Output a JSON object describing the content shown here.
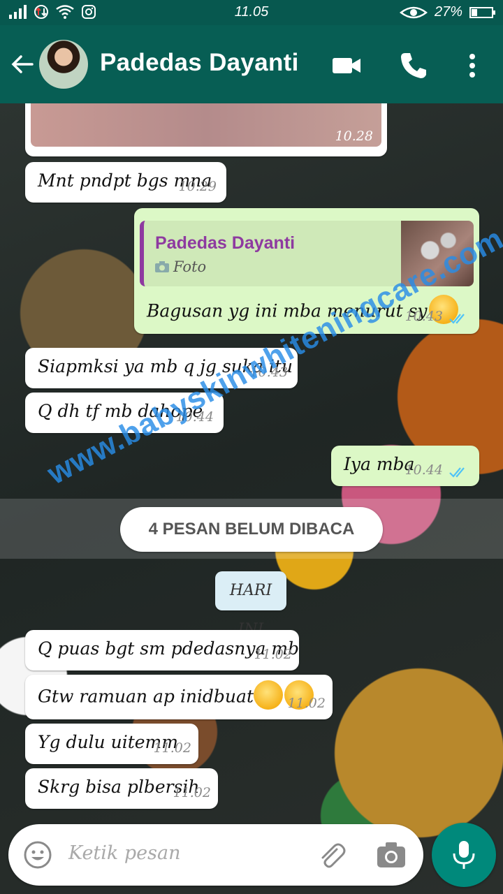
{
  "status_bar": {
    "time": "11.05",
    "battery": "27%",
    "battery_level": 0.27
  },
  "header": {
    "contact_name": "Padedas Dayanti"
  },
  "messages": [
    {
      "text": "",
      "time": "10.28"
    },
    {
      "text": "Mnt pndpt bgs mna",
      "time": "10.29"
    },
    {
      "quote_name": "Padedas Dayanti",
      "quote_type": "Foto",
      "text": "Bagusan yg ini mba menurut sy",
      "time": "10.43"
    },
    {
      "text": "Siapmksi ya mb q jg suka itu",
      "time": "10.43"
    },
    {
      "text": "Q dh tf mb dahope",
      "time": "10.44"
    },
    {
      "text": "Iya mba",
      "time": "10.44"
    },
    {
      "text": "Q puas bgt sm pdedasnya mb",
      "time": "11.02"
    },
    {
      "text": "Gtw ramuan ap inidbuat",
      "time": "11.02"
    },
    {
      "text": "Yg dulu uitemm",
      "time": "11.02"
    },
    {
      "text": "Skrg bisa plbersih",
      "time": "11.02"
    }
  ],
  "unread_banner": "4 PESAN BELUM DIBACA",
  "date_chip": "HARI INI",
  "watermark": "www.babyskinwhiteningcare.com",
  "composer": {
    "placeholder": "Ketik pesan"
  },
  "colors": {
    "header": "#075e54",
    "outgoing": "#dcf8c6",
    "incoming": "#ffffff",
    "read_ticks": "#4fc3f7",
    "mic_button": "#00897b"
  }
}
